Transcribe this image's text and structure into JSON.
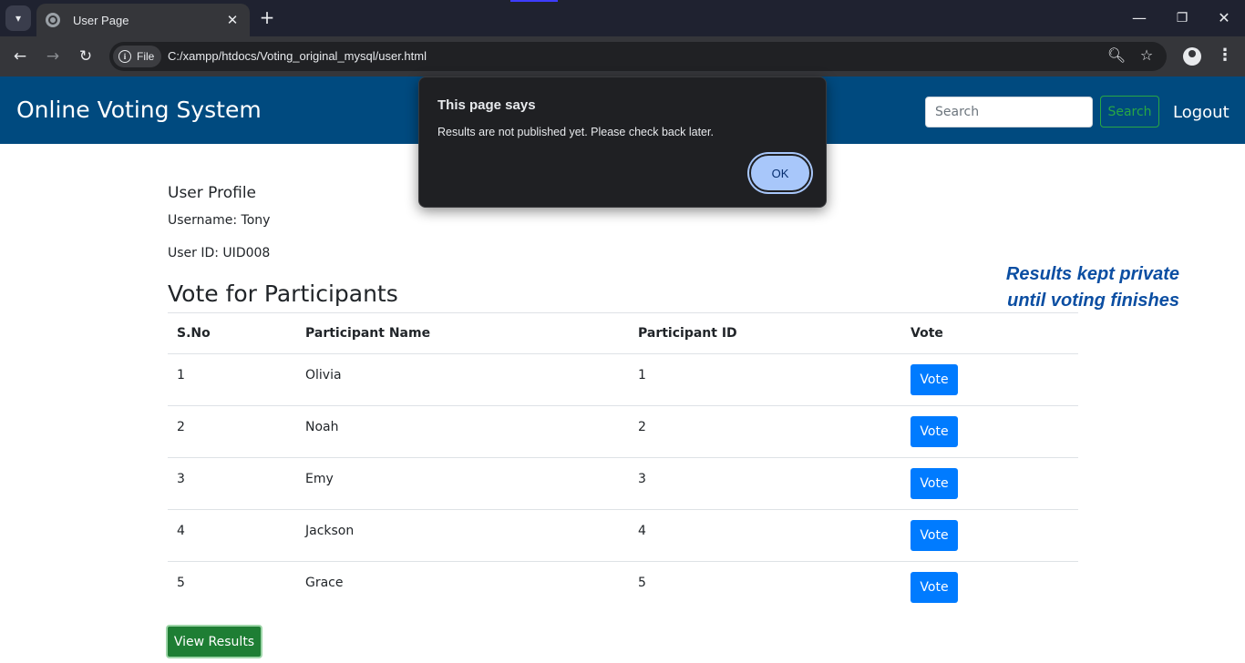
{
  "browser": {
    "tab_title": "User Page",
    "chip_label": "File",
    "url": "C:/xampp/htdocs/Voting_original_mysql/user.html"
  },
  "navbar": {
    "brand": "Online Voting System",
    "search_placeholder": "Search",
    "search_button": "Search",
    "logout": "Logout"
  },
  "profile": {
    "title": "User Profile",
    "username_line": "Username: Tony",
    "userid_line": "User ID: UID008"
  },
  "section_title": "Vote for Participants",
  "side_note": {
    "line1": "Results kept private",
    "line2": "until voting finishes"
  },
  "table": {
    "headers": [
      "S.No",
      "Participant Name",
      "Participant ID",
      "Vote"
    ],
    "rows": [
      {
        "sno": "1",
        "name": "Olivia",
        "pid": "1",
        "vote": "Vote"
      },
      {
        "sno": "2",
        "name": "Noah",
        "pid": "2",
        "vote": "Vote"
      },
      {
        "sno": "3",
        "name": "Emy",
        "pid": "3",
        "vote": "Vote"
      },
      {
        "sno": "4",
        "name": "Jackson",
        "pid": "4",
        "vote": "Vote"
      },
      {
        "sno": "5",
        "name": "Grace",
        "pid": "5",
        "vote": "Vote"
      }
    ]
  },
  "results_button": "View Results",
  "dialog": {
    "title": "This page says",
    "message": "Results are not published yet. Please check back later.",
    "ok": "OK"
  },
  "colors": {
    "navbar": "#004a7f",
    "vote_button": "#007bff",
    "results_button": "#1e7e34",
    "side_note": "#0b4ea2"
  }
}
